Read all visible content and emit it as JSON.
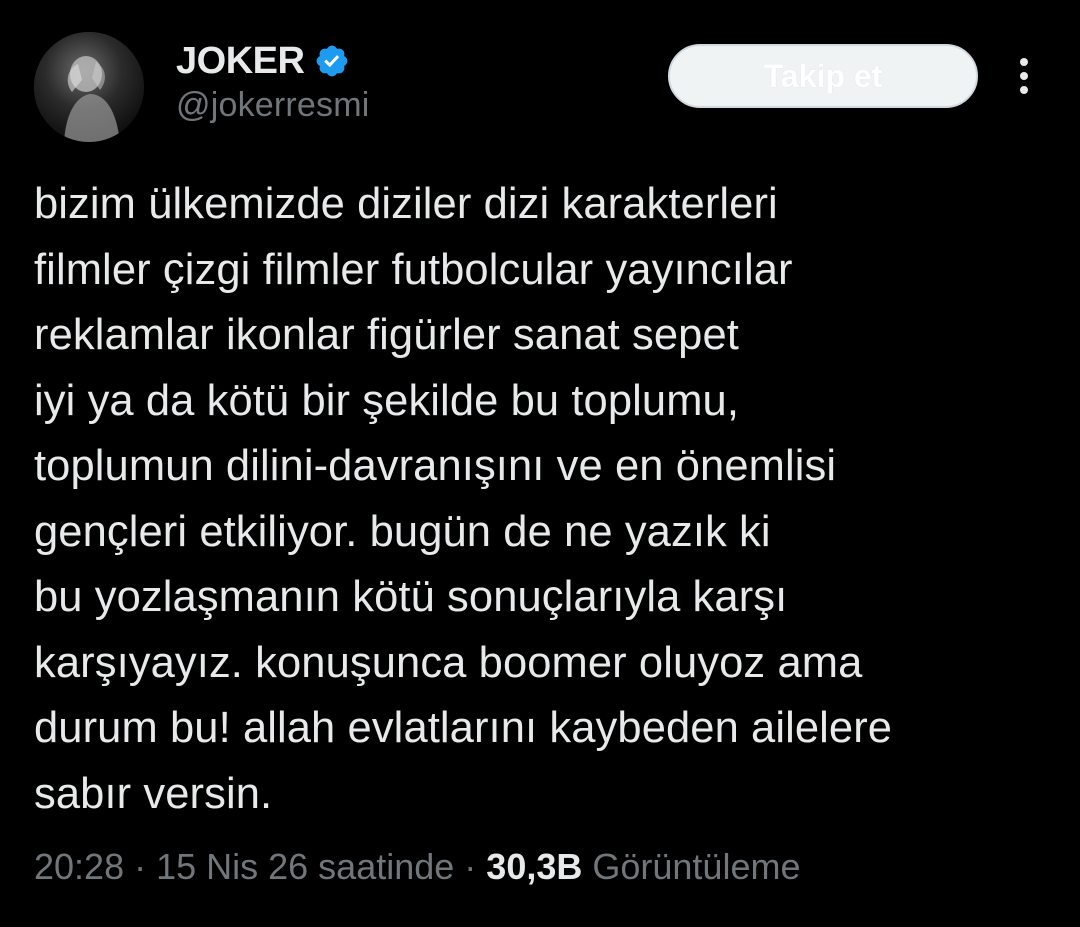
{
  "author": {
    "display_name": "JOKER",
    "handle": "@jokerresmi",
    "verified": true,
    "verified_icon": "verified-badge-icon",
    "avatar_icon": "profile-avatar"
  },
  "header": {
    "follow_label": "Takip et",
    "more_icon": "more-vertical-icon"
  },
  "tweet": {
    "text": "bizim ülkemizde diziler dizi karakterleri\nfilmler çizgi filmler futbolcular yayıncılar\nreklamlar ikonlar figürler sanat sepet\niyi ya da kötü bir şekilde bu toplumu,\ntoplumun dilini-davranışını ve en önemlisi\ngençleri etkiliyor. bugün de ne yazık ki\nbu yozlaşmanın kötü sonuçlarıyla karşı\nkarşıyayız. konuşunca boomer oluyoz ama\ndurum bu! allah evlatlarını kaybeden ailelere\nsabır versin."
  },
  "meta": {
    "time": "20:28",
    "separator": "·",
    "date": "15 Nis 26 saatinde",
    "views_count": "30,3B",
    "views_label": "Görüntüleme"
  },
  "colors": {
    "background": "#000000",
    "primary_text": "#e7e9ea",
    "secondary_text": "#71767b",
    "verified_blue": "#1d9bf0",
    "follow_button_bg": "#eff3f4"
  }
}
